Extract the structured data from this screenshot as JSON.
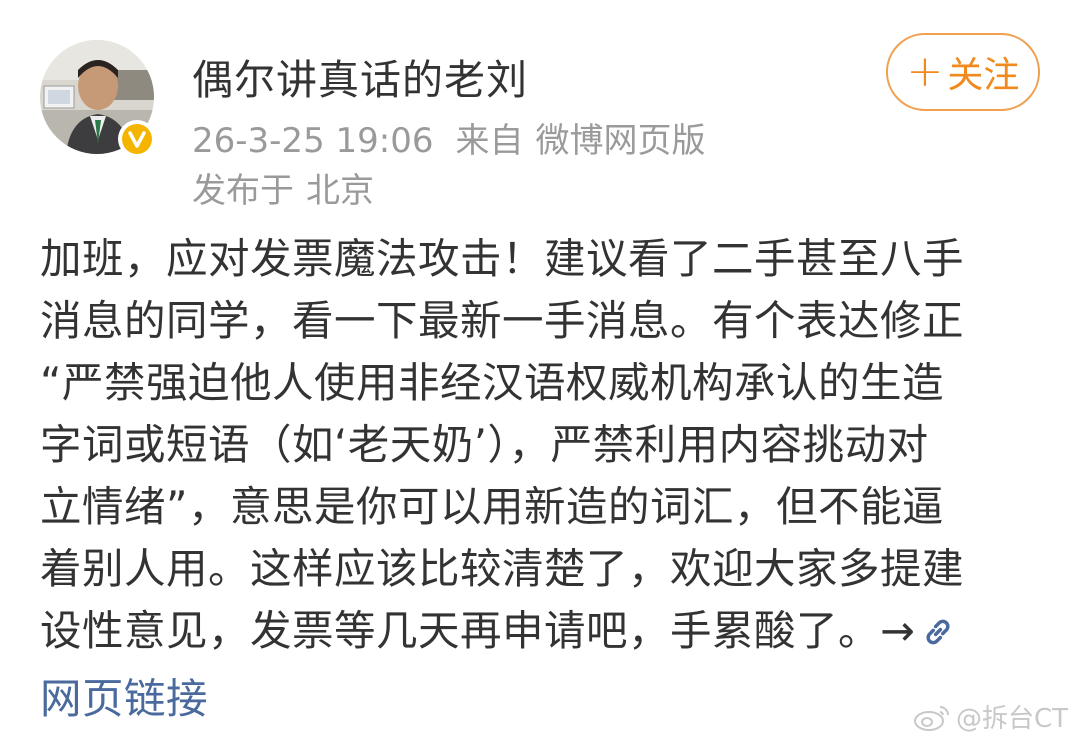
{
  "post": {
    "user_name": "偶尔讲真话的老刘",
    "timestamp": "26-3-25 19:06",
    "source_prefix": "来自",
    "source": "微博网页版",
    "location_prefix": "发布于",
    "location": "北京",
    "follow_label": "关注",
    "text_lines": [
      "加班，应对发票魔法攻击！建议看了二手甚至八手",
      "消息的同学，看一下最新一手消息。有个表达修正",
      "“严禁强迫他人使用非经汉语权威机构承认的生造",
      "字词或短语（如‘老天奶’），严禁利用内容挑动对",
      "立情绪”，意思是你可以用新造的词汇，但不能逼",
      "着别人用。这样应该比较清楚了，欢迎大家多提建",
      "设性意见，发票等几天再申请吧，手累酸了。→"
    ],
    "link_label": "网页链接",
    "link_icon": "link-icon"
  },
  "watermark": {
    "text": "@拆台CT",
    "icon": "weibo-logo-icon"
  },
  "colors": {
    "accent": "#f08a1c",
    "link": "#4a6a9e",
    "badge": "#f5b400",
    "meta": "#9a9a9a",
    "text": "#333333"
  }
}
